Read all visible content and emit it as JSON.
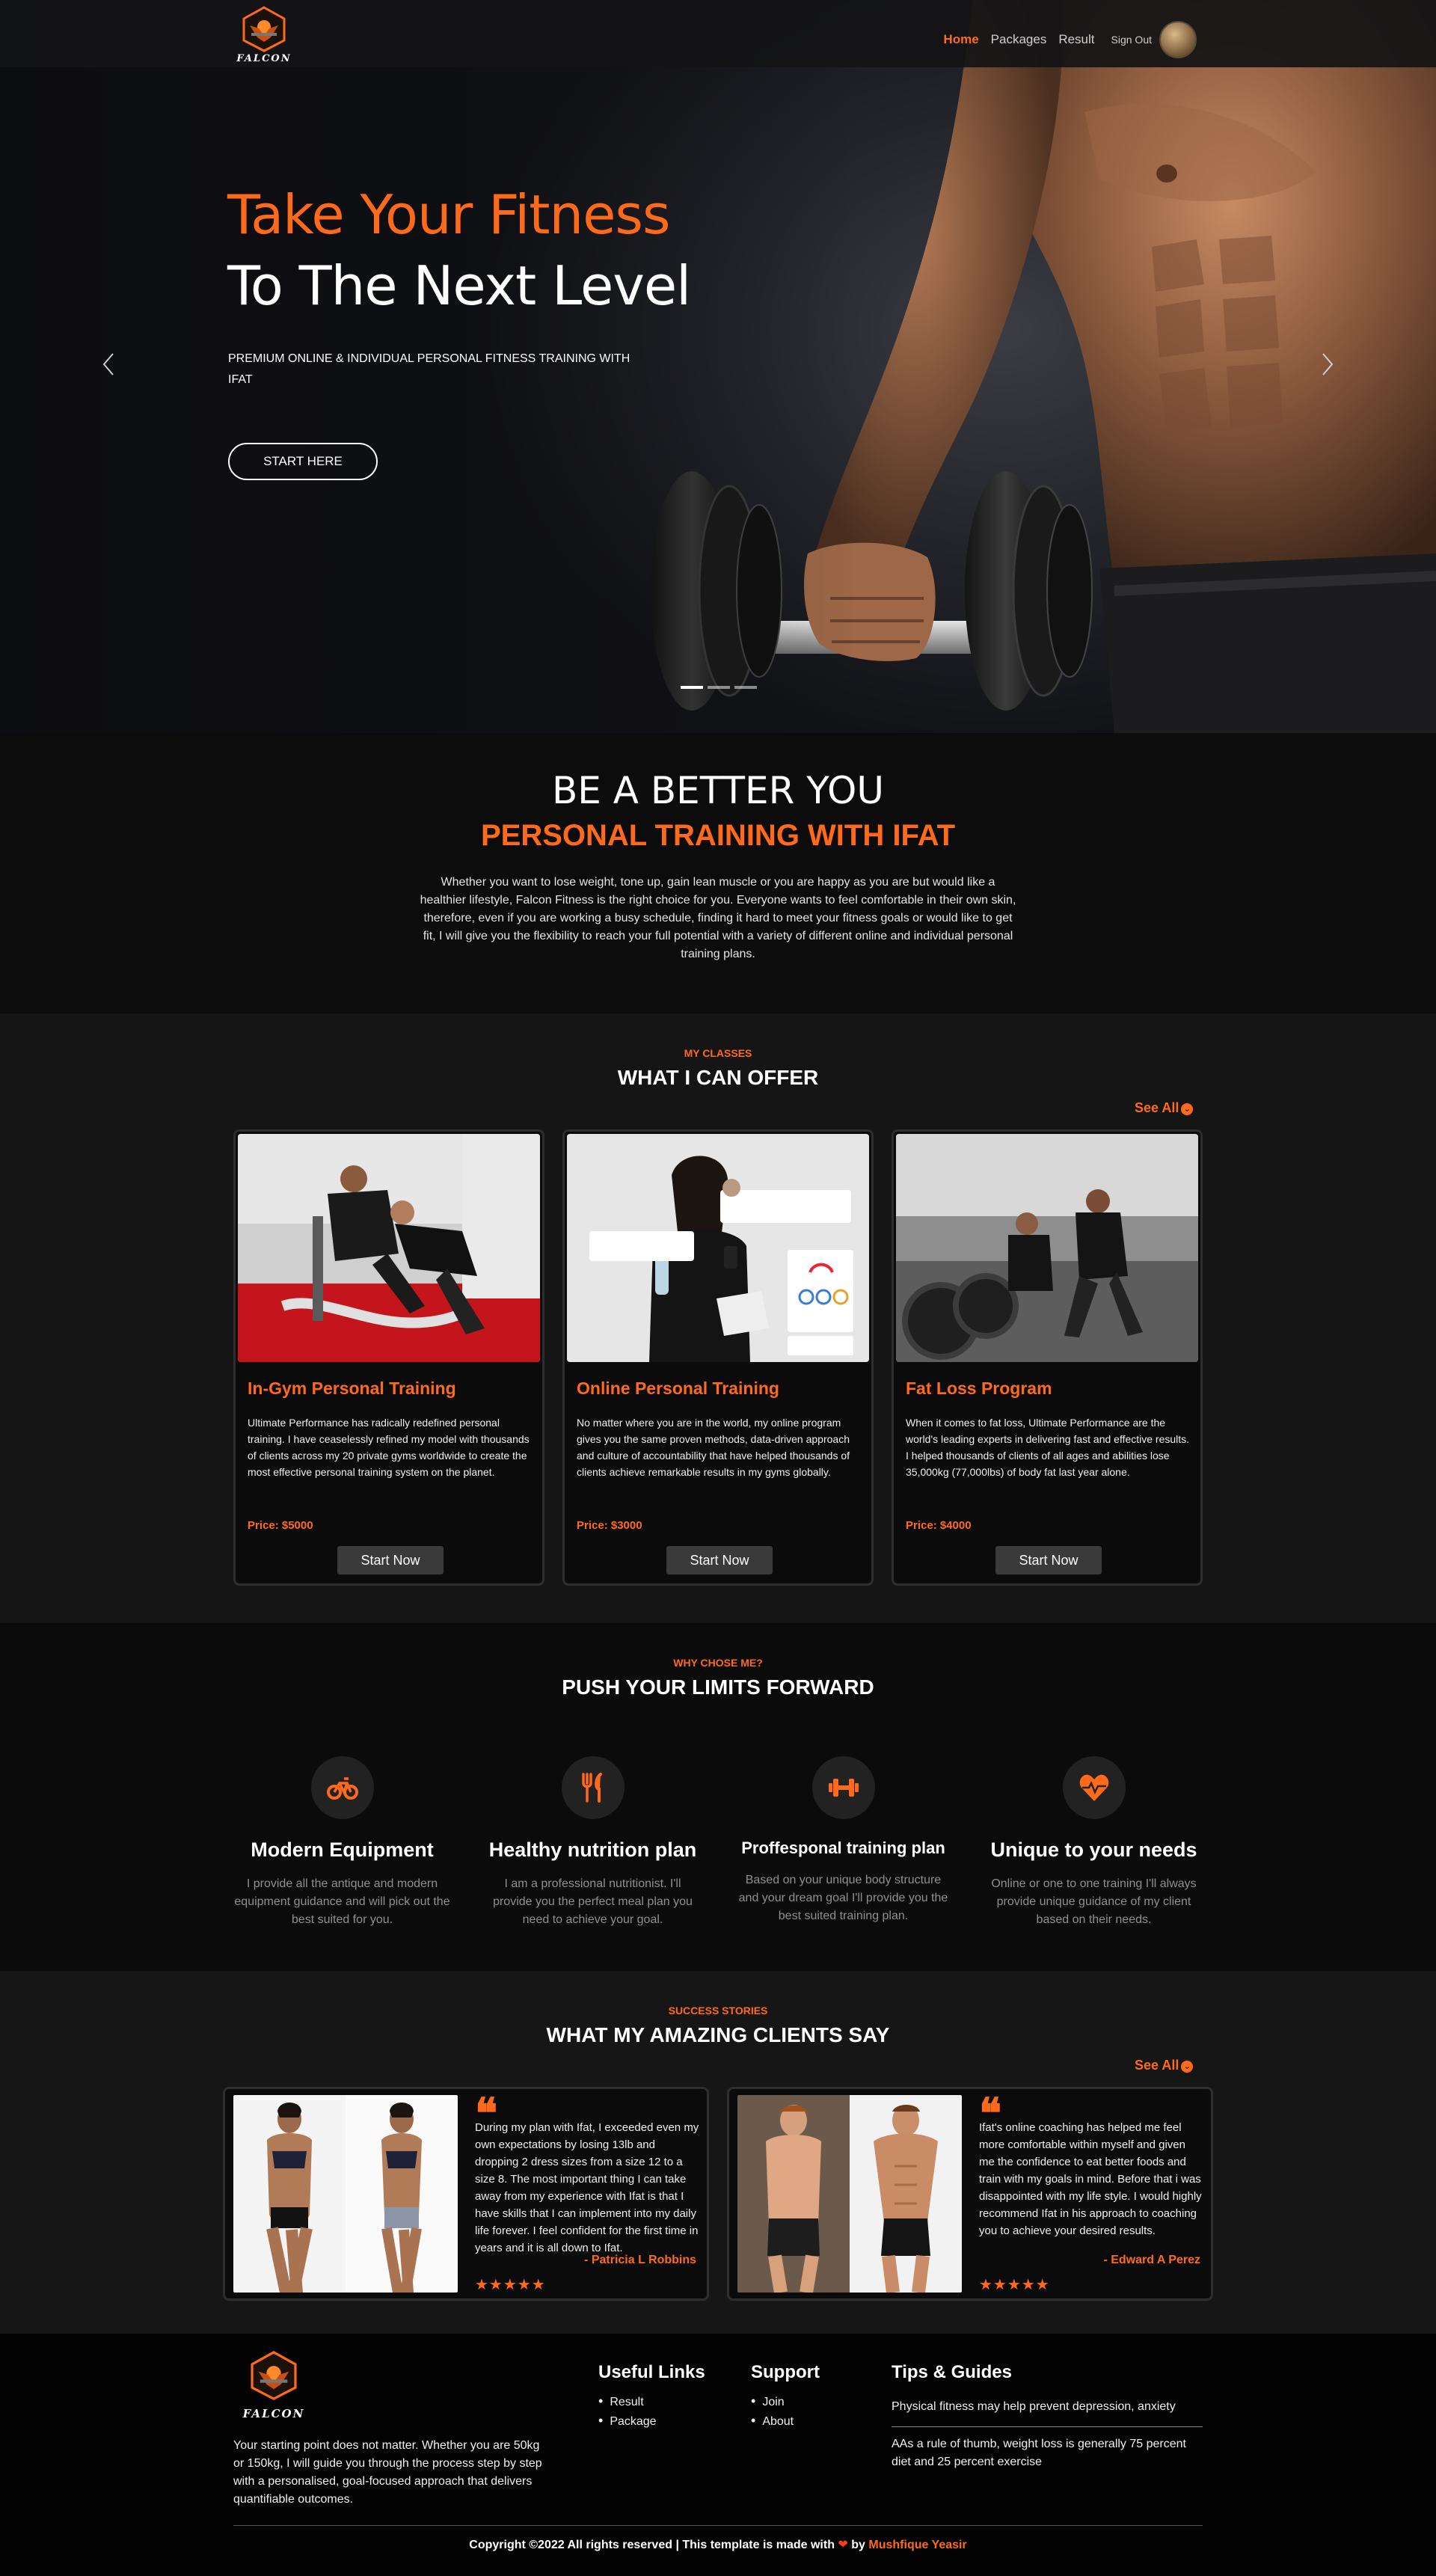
{
  "nav": {
    "logo_text": "FALCON",
    "links": [
      {
        "label": "Home",
        "active": true
      },
      {
        "label": "Packages",
        "active": false
      },
      {
        "label": "Result",
        "active": false
      }
    ],
    "signout_label": "Sign Out"
  },
  "hero": {
    "title_line1": "Take Your Fitness",
    "title_line2": "To The Next Level",
    "subtitle": "PREMIUM ONLINE & INDIVIDUAL PERSONAL FITNESS TRAINING WITH IFAT",
    "cta_label": "START HERE",
    "prev_icon": "chevron-left-icon",
    "next_icon": "chevron-right-icon",
    "slide_count": 3,
    "active_slide": 1
  },
  "about": {
    "heading": "BE A BETTER YOU",
    "subheading": "PERSONAL TRAINING WITH IFAT",
    "body": "Whether you want to lose weight, tone up, gain lean muscle or you are happy as you are but would like a healthier lifestyle, Falcon Fitness is the right choice for you. Everyone wants to feel comfortable in their own skin, therefore, even if you are working a busy schedule, finding it hard to meet your fitness goals or would like to get fit, I will give you the flexibility to reach your full potential with a variety of different online and individual personal training plans."
  },
  "classes": {
    "eyebrow": "MY CLASSES",
    "title": "WHAT I CAN OFFER",
    "see_all": "See All",
    "items": [
      {
        "title": "In-Gym Personal Training",
        "description": "Ultimate Performance has radically redefined personal training. I have ceaselessly refined my model with thousands of clients across my 20 private gyms worldwide to create the most effective personal training system on the planet.",
        "price": "Price: $5000",
        "button": "Start Now"
      },
      {
        "title": "Online Personal Training",
        "description": "No matter where you are in the world, my online program gives you the same proven methods, data-driven approach and culture of accountability that have helped thousands of clients achieve remarkable results in my gyms globally.",
        "price": "Price: $3000",
        "button": "Start Now"
      },
      {
        "title": "Fat Loss Program",
        "description": "When it comes to fat loss, Ultimate Performance are the world's leading experts in delivering fast and effective results. I helped thousands of clients of all ages and abilities lose 35,000kg (77,000lbs) of body fat last year alone.",
        "price": "Price: $4000",
        "button": "Start Now"
      }
    ]
  },
  "why": {
    "eyebrow": "WHY CHOSE ME?",
    "title": "PUSH YOUR LIMITS FORWARD",
    "features": [
      {
        "icon": "bicycle-icon",
        "title": "Modern Equipment",
        "description": "I provide all the antique and modern equipment guidance and will pick out the best suited for you."
      },
      {
        "icon": "utensils-icon",
        "title": "Healthy nutrition plan",
        "description": "I am a professional nutritionist. I'll provide you the perfect meal plan you need to achieve your goal."
      },
      {
        "icon": "dumbbell-icon",
        "title": "Proffesponal training plan",
        "description": "Based on your unique body structure and your dream goal I'll provide you the best suited training plan."
      },
      {
        "icon": "heartbeat-icon",
        "title": "Unique to your needs",
        "description": "Online or one to one training I'll always provide unique guidance of my client based on their needs."
      }
    ]
  },
  "stories": {
    "eyebrow": "SUCCESS STORIES",
    "title": "WHAT MY AMAZING CLIENTS SAY",
    "see_all": "See All",
    "items": [
      {
        "quote": "During my plan with Ifat, I exceeded even my own expectations by losing 13lb and dropping 2 dress sizes from a size 12 to a size 8. The most important thing I can take away from my experience with Ifat is that I have skills that I can implement into my daily life forever. I feel confident for the first time in years and it is all down to Ifat.",
        "author": "- Patricia L Robbins",
        "stars": "★★★★★",
        "rating": 5
      },
      {
        "quote": "Ifat's online coaching has helped me feel more comfortable within myself and given me the confidence to eat better foods and train with my goals in mind. Before that i was disappointed with my life style. I would highly recommend Ifat in his approach to coaching you to achieve your desired results.",
        "author": "- Edward A Perez",
        "stars": "★★★★★",
        "rating": 5
      }
    ]
  },
  "footer": {
    "logo_text": "FALCON",
    "about": "Your starting point does not matter. Whether you are 50kg or 150kg, I will guide you through the process step by step with a personalised, goal-focused approach that delivers quantifiable outcomes.",
    "useful_links": {
      "title": "Useful Links",
      "items": [
        "Result",
        "Package"
      ]
    },
    "support": {
      "title": "Support",
      "items": [
        "Join",
        "About"
      ]
    },
    "tips": {
      "title": "Tips & Guides",
      "items": [
        "Physical fitness may help prevent depression, anxiety",
        "AAs a rule of thumb, weight loss is generally 75 percent diet and 25 percent exercise"
      ]
    },
    "copyright_prefix": "Copyright ©2022 All rights reserved | This template is made with",
    "copyright_by": "by",
    "copyright_author": "Mushfique Yeasir"
  },
  "colors": {
    "accent": "#ff6a1a",
    "background": "#0b0b0b",
    "panel": "#151515"
  }
}
